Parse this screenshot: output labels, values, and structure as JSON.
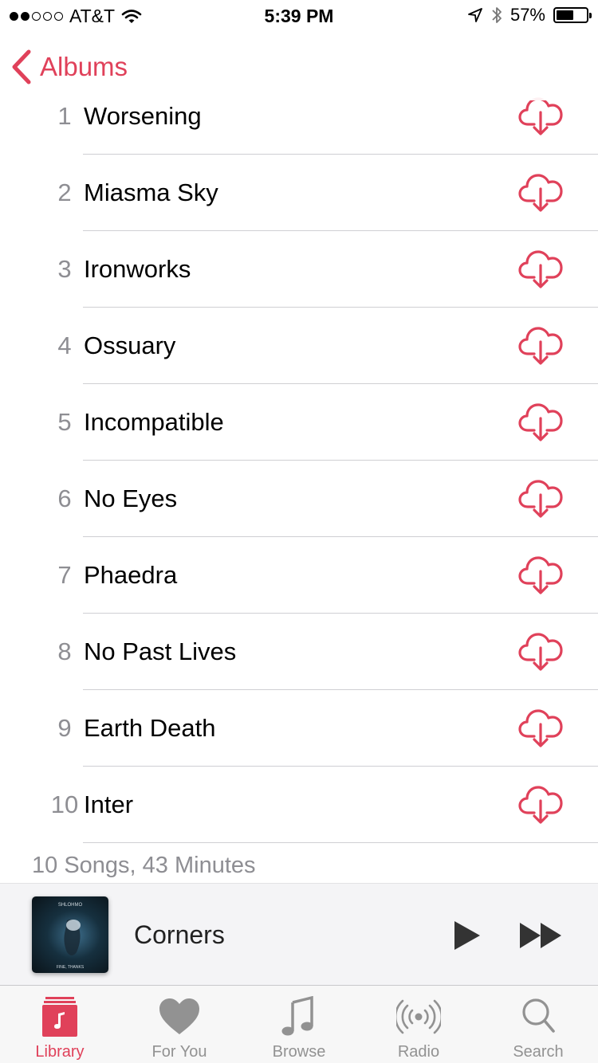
{
  "status_bar": {
    "carrier": "AT&T",
    "time": "5:39 PM",
    "battery": "57%",
    "battery_level": 0.57,
    "signal_bars": 2
  },
  "nav": {
    "back_label": "Albums",
    "back_icon": "chevron-left-icon"
  },
  "accent_color": "#e0415a",
  "tracks": [
    {
      "number": "1",
      "title": "Worsening"
    },
    {
      "number": "2",
      "title": "Miasma Sky"
    },
    {
      "number": "3",
      "title": "Ironworks"
    },
    {
      "number": "4",
      "title": "Ossuary"
    },
    {
      "number": "5",
      "title": "Incompatible"
    },
    {
      "number": "6",
      "title": "No Eyes"
    },
    {
      "number": "7",
      "title": "Phaedra"
    },
    {
      "number": "8",
      "title": "No Past Lives"
    },
    {
      "number": "9",
      "title": "Earth Death"
    },
    {
      "number": "10",
      "title": "Inter"
    }
  ],
  "track_action_icon": "cloud-download-icon",
  "album_summary": "10 Songs, 43 Minutes",
  "now_playing": {
    "title": "Corners",
    "artwork_artist": "SHLOHMO",
    "artwork_album": "FINE, THANKS"
  },
  "tabs": [
    {
      "label": "Library",
      "icon": "library-icon",
      "active": true
    },
    {
      "label": "For You",
      "icon": "heart-icon",
      "active": false
    },
    {
      "label": "Browse",
      "icon": "music-note-icon",
      "active": false
    },
    {
      "label": "Radio",
      "icon": "radio-icon",
      "active": false
    },
    {
      "label": "Search",
      "icon": "search-icon",
      "active": false
    }
  ]
}
